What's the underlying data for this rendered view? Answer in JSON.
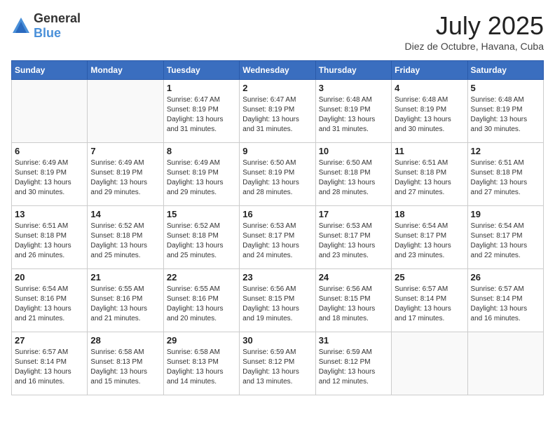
{
  "header": {
    "logo_general": "General",
    "logo_blue": "Blue",
    "title": "July 2025",
    "subtitle": "Diez de Octubre, Havana, Cuba"
  },
  "weekdays": [
    "Sunday",
    "Monday",
    "Tuesday",
    "Wednesday",
    "Thursday",
    "Friday",
    "Saturday"
  ],
  "weeks": [
    [
      {
        "day": "",
        "sunrise": "",
        "sunset": "",
        "daylight": ""
      },
      {
        "day": "",
        "sunrise": "",
        "sunset": "",
        "daylight": ""
      },
      {
        "day": "1",
        "sunrise": "Sunrise: 6:47 AM",
        "sunset": "Sunset: 8:19 PM",
        "daylight": "Daylight: 13 hours and 31 minutes."
      },
      {
        "day": "2",
        "sunrise": "Sunrise: 6:47 AM",
        "sunset": "Sunset: 8:19 PM",
        "daylight": "Daylight: 13 hours and 31 minutes."
      },
      {
        "day": "3",
        "sunrise": "Sunrise: 6:48 AM",
        "sunset": "Sunset: 8:19 PM",
        "daylight": "Daylight: 13 hours and 31 minutes."
      },
      {
        "day": "4",
        "sunrise": "Sunrise: 6:48 AM",
        "sunset": "Sunset: 8:19 PM",
        "daylight": "Daylight: 13 hours and 30 minutes."
      },
      {
        "day": "5",
        "sunrise": "Sunrise: 6:48 AM",
        "sunset": "Sunset: 8:19 PM",
        "daylight": "Daylight: 13 hours and 30 minutes."
      }
    ],
    [
      {
        "day": "6",
        "sunrise": "Sunrise: 6:49 AM",
        "sunset": "Sunset: 8:19 PM",
        "daylight": "Daylight: 13 hours and 30 minutes."
      },
      {
        "day": "7",
        "sunrise": "Sunrise: 6:49 AM",
        "sunset": "Sunset: 8:19 PM",
        "daylight": "Daylight: 13 hours and 29 minutes."
      },
      {
        "day": "8",
        "sunrise": "Sunrise: 6:49 AM",
        "sunset": "Sunset: 8:19 PM",
        "daylight": "Daylight: 13 hours and 29 minutes."
      },
      {
        "day": "9",
        "sunrise": "Sunrise: 6:50 AM",
        "sunset": "Sunset: 8:19 PM",
        "daylight": "Daylight: 13 hours and 28 minutes."
      },
      {
        "day": "10",
        "sunrise": "Sunrise: 6:50 AM",
        "sunset": "Sunset: 8:18 PM",
        "daylight": "Daylight: 13 hours and 28 minutes."
      },
      {
        "day": "11",
        "sunrise": "Sunrise: 6:51 AM",
        "sunset": "Sunset: 8:18 PM",
        "daylight": "Daylight: 13 hours and 27 minutes."
      },
      {
        "day": "12",
        "sunrise": "Sunrise: 6:51 AM",
        "sunset": "Sunset: 8:18 PM",
        "daylight": "Daylight: 13 hours and 27 minutes."
      }
    ],
    [
      {
        "day": "13",
        "sunrise": "Sunrise: 6:51 AM",
        "sunset": "Sunset: 8:18 PM",
        "daylight": "Daylight: 13 hours and 26 minutes."
      },
      {
        "day": "14",
        "sunrise": "Sunrise: 6:52 AM",
        "sunset": "Sunset: 8:18 PM",
        "daylight": "Daylight: 13 hours and 25 minutes."
      },
      {
        "day": "15",
        "sunrise": "Sunrise: 6:52 AM",
        "sunset": "Sunset: 8:18 PM",
        "daylight": "Daylight: 13 hours and 25 minutes."
      },
      {
        "day": "16",
        "sunrise": "Sunrise: 6:53 AM",
        "sunset": "Sunset: 8:17 PM",
        "daylight": "Daylight: 13 hours and 24 minutes."
      },
      {
        "day": "17",
        "sunrise": "Sunrise: 6:53 AM",
        "sunset": "Sunset: 8:17 PM",
        "daylight": "Daylight: 13 hours and 23 minutes."
      },
      {
        "day": "18",
        "sunrise": "Sunrise: 6:54 AM",
        "sunset": "Sunset: 8:17 PM",
        "daylight": "Daylight: 13 hours and 23 minutes."
      },
      {
        "day": "19",
        "sunrise": "Sunrise: 6:54 AM",
        "sunset": "Sunset: 8:17 PM",
        "daylight": "Daylight: 13 hours and 22 minutes."
      }
    ],
    [
      {
        "day": "20",
        "sunrise": "Sunrise: 6:54 AM",
        "sunset": "Sunset: 8:16 PM",
        "daylight": "Daylight: 13 hours and 21 minutes."
      },
      {
        "day": "21",
        "sunrise": "Sunrise: 6:55 AM",
        "sunset": "Sunset: 8:16 PM",
        "daylight": "Daylight: 13 hours and 21 minutes."
      },
      {
        "day": "22",
        "sunrise": "Sunrise: 6:55 AM",
        "sunset": "Sunset: 8:16 PM",
        "daylight": "Daylight: 13 hours and 20 minutes."
      },
      {
        "day": "23",
        "sunrise": "Sunrise: 6:56 AM",
        "sunset": "Sunset: 8:15 PM",
        "daylight": "Daylight: 13 hours and 19 minutes."
      },
      {
        "day": "24",
        "sunrise": "Sunrise: 6:56 AM",
        "sunset": "Sunset: 8:15 PM",
        "daylight": "Daylight: 13 hours and 18 minutes."
      },
      {
        "day": "25",
        "sunrise": "Sunrise: 6:57 AM",
        "sunset": "Sunset: 8:14 PM",
        "daylight": "Daylight: 13 hours and 17 minutes."
      },
      {
        "day": "26",
        "sunrise": "Sunrise: 6:57 AM",
        "sunset": "Sunset: 8:14 PM",
        "daylight": "Daylight: 13 hours and 16 minutes."
      }
    ],
    [
      {
        "day": "27",
        "sunrise": "Sunrise: 6:57 AM",
        "sunset": "Sunset: 8:14 PM",
        "daylight": "Daylight: 13 hours and 16 minutes."
      },
      {
        "day": "28",
        "sunrise": "Sunrise: 6:58 AM",
        "sunset": "Sunset: 8:13 PM",
        "daylight": "Daylight: 13 hours and 15 minutes."
      },
      {
        "day": "29",
        "sunrise": "Sunrise: 6:58 AM",
        "sunset": "Sunset: 8:13 PM",
        "daylight": "Daylight: 13 hours and 14 minutes."
      },
      {
        "day": "30",
        "sunrise": "Sunrise: 6:59 AM",
        "sunset": "Sunset: 8:12 PM",
        "daylight": "Daylight: 13 hours and 13 minutes."
      },
      {
        "day": "31",
        "sunrise": "Sunrise: 6:59 AM",
        "sunset": "Sunset: 8:12 PM",
        "daylight": "Daylight: 13 hours and 12 minutes."
      },
      {
        "day": "",
        "sunrise": "",
        "sunset": "",
        "daylight": ""
      },
      {
        "day": "",
        "sunrise": "",
        "sunset": "",
        "daylight": ""
      }
    ]
  ]
}
